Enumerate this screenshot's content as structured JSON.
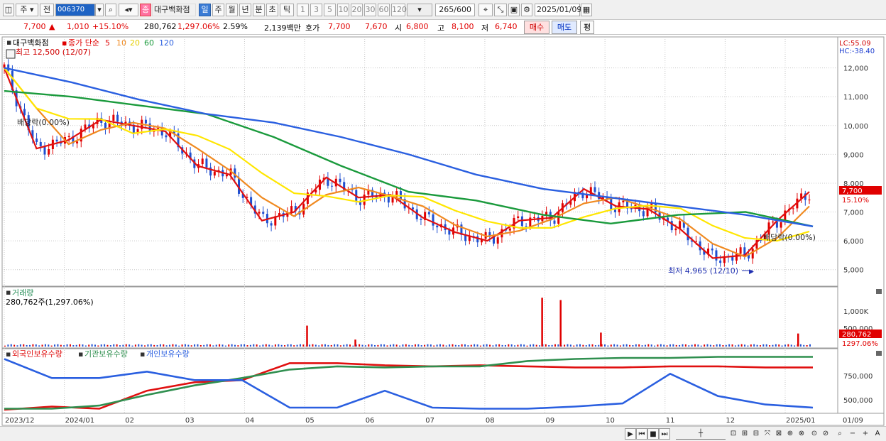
{
  "toolbar": {
    "period_type": "주",
    "prev_label": "전",
    "stock_code": "006370",
    "category_tag": "종",
    "stock_name": "대구백화점",
    "periods": [
      "일",
      "주",
      "월",
      "년",
      "분",
      "초",
      "틱"
    ],
    "selected_period": "일",
    "intervals": [
      "1",
      "3",
      "5",
      "10",
      "20",
      "30",
      "60",
      "120"
    ],
    "count": "265",
    "count_total": "/600",
    "date": "2025/01/09"
  },
  "infobar": {
    "price": "7,700",
    "change_arrow": "▲",
    "change": "1,010",
    "change_pct": "+15.10%",
    "volume": "280,762",
    "volume_pct": "1,297.06%",
    "turnover": "2.59%",
    "amount": "2,139백만",
    "quote_label": "호가",
    "ask": "7,700",
    "bid": "7,670",
    "open_label": "시",
    "open": "6,800",
    "high_label": "고",
    "high": "8,100",
    "low_label": "저",
    "low": "6,740",
    "buy_label": "매수",
    "sell_label": "매도",
    "flat_label": "평"
  },
  "colors": {
    "up": "#e00000",
    "down": "#1f4fd0",
    "ma5": "#e01010",
    "ma10": "#f08a20",
    "ma20": "#ffe600",
    "ma60": "#1a9a3c",
    "ma120": "#2a5fe0",
    "foreign": "#e01010",
    "institution": "#2f8f4f",
    "individual": "#2a5fe0",
    "grid": "#c8c8c8"
  },
  "chart_data": [
    {
      "type": "candlestick",
      "title": "대구백화점",
      "legend": {
        "label": "종가 단순",
        "periods": [
          "5",
          "10",
          "20",
          "60",
          "120"
        ]
      },
      "y_ticks": [
        "12,000",
        "11,000",
        "10,000",
        "9,000",
        "8,000",
        "7,000",
        "6,000",
        "5,000"
      ],
      "ylim": [
        4500,
        13000
      ],
      "x_ticks": [
        "2023/12",
        "2024/01",
        "02",
        "03",
        "04",
        "05",
        "06",
        "07",
        "08",
        "09",
        "10",
        "11",
        "12",
        "2025/01",
        "01/09"
      ],
      "annotations": {
        "high": "최고 12,500 (12/07)",
        "low": "최저 4,965 (12/10)",
        "dividend_left": "배당락(0.00%)",
        "dividend_right": "배당락(0.00%)"
      },
      "scale_labels": [
        "LC:55.09",
        "HC:-38.40"
      ],
      "last_price_label": "7,700",
      "last_change_label": "15.10%",
      "close_series": [
        {
          "x": "2023/12",
          "y": 12000
        },
        {
          "x": "2024/01 mid",
          "y": 9200
        },
        {
          "x": "2024/01 end",
          "y": 9500
        },
        {
          "x": "02 early",
          "y": 10200
        },
        {
          "x": "02 mid",
          "y": 10000
        },
        {
          "x": "03 early",
          "y": 9800
        },
        {
          "x": "03 mid",
          "y": 8600
        },
        {
          "x": "04 early",
          "y": 8300
        },
        {
          "x": "04 end",
          "y": 6700
        },
        {
          "x": "05 early",
          "y": 7000
        },
        {
          "x": "05 end",
          "y": 8200
        },
        {
          "x": "06 mid",
          "y": 7500
        },
        {
          "x": "07 early",
          "y": 7600
        },
        {
          "x": "07 end",
          "y": 6800
        },
        {
          "x": "08 early",
          "y": 6300
        },
        {
          "x": "08 end",
          "y": 6000
        },
        {
          "x": "09 early",
          "y": 6700
        },
        {
          "x": "09 end",
          "y": 6800
        },
        {
          "x": "10 early",
          "y": 7800
        },
        {
          "x": "10 end",
          "y": 7200
        },
        {
          "x": "11 early",
          "y": 7100
        },
        {
          "x": "11 end",
          "y": 6400
        },
        {
          "x": "12 mid",
          "y": 5400
        },
        {
          "x": "12 end",
          "y": 5500
        },
        {
          "x": "2025/01",
          "y": 6700
        },
        {
          "x": "01/09",
          "y": 7700
        }
      ],
      "ma120_series": [
        12000,
        11500,
        10900,
        10400,
        10100,
        9600,
        9000,
        8300,
        7800,
        7500,
        7200,
        6900,
        6500
      ],
      "ma60_series": [
        11200,
        11000,
        10700,
        10400,
        9600,
        8600,
        7700,
        7400,
        6900,
        6600,
        6900,
        7000,
        6500
      ]
    },
    {
      "type": "bar",
      "title": "거래량",
      "subtitle": "280,762주(1,297.06%)",
      "y_ticks": [
        "1,000K",
        "500,000"
      ],
      "last_value_label": "280,762",
      "last_pct_label": "1297.06%",
      "spikes": [
        {
          "x": "05 early",
          "value": 450000
        },
        {
          "x": "06 mid",
          "value": 150000
        },
        {
          "x": "09 early",
          "value": 1050000
        },
        {
          "x": "09 early b",
          "value": 1000000
        },
        {
          "x": "10 early",
          "value": 300000
        },
        {
          "x": "01/09",
          "value": 280762
        }
      ]
    },
    {
      "type": "line",
      "series_names": [
        "외국인보유수량",
        "기관보유수량",
        "개인보유수량"
      ],
      "y_ticks": [
        "750,000",
        "500,000"
      ],
      "series": [
        {
          "name": "외국인보유수량",
          "values": [
            420000,
            450000,
            430000,
            600000,
            680000,
            700000,
            860000,
            860000,
            840000,
            830000,
            840000,
            830000,
            820000,
            820000,
            830000,
            830000,
            820000,
            820000
          ]
        },
        {
          "name": "기관보유수량",
          "values": [
            430000,
            430000,
            460000,
            560000,
            650000,
            720000,
            800000,
            830000,
            820000,
            830000,
            830000,
            880000,
            900000,
            910000,
            910000,
            920000,
            920000,
            920000
          ]
        },
        {
          "name": "개인보유수량",
          "values": [
            900000,
            720000,
            720000,
            780000,
            700000,
            700000,
            440000,
            440000,
            600000,
            440000,
            430000,
            430000,
            450000,
            480000,
            760000,
            550000,
            470000,
            440000
          ]
        }
      ]
    }
  ],
  "bottom": {
    "x_last": "01/09"
  }
}
